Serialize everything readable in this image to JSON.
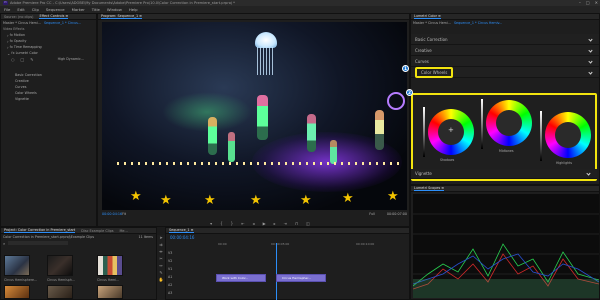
{
  "titlebar": {
    "app_icon": "Pr",
    "title": "Adobe Premiere Pro CC - C:\\Users\\ADOBE\\My Documents\\Adobe\\Premiere Pro\\10.0\\Color Correction in Premiere_start.prproj *",
    "minimize": "–",
    "maximize": "□",
    "close": "✕"
  },
  "menu": [
    "File",
    "Edit",
    "Clip",
    "Sequence",
    "Marker",
    "Title",
    "Window",
    "Help"
  ],
  "left_panel": {
    "tabs": [
      "Source: (no clips)",
      "Effect Controls ≡",
      "Audio Clip Mixer"
    ],
    "master_label": "Master * Circus Hemi...",
    "sequence_label": "Sequence_1 * Circus...",
    "section": "Video Effects",
    "effects": [
      {
        "name": "fx  Motion"
      },
      {
        "name": "fx  Opacity"
      },
      {
        "name": "fx  Time Remapping"
      },
      {
        "name": "fx  Lumetri Color"
      }
    ],
    "lumetri_master": "High Dynamic...",
    "sub_items": [
      "Basic Correction",
      "Creative",
      "Curves",
      "Color Wheels",
      "Vignette"
    ]
  },
  "program": {
    "tab": "Program: Sequence_1 ≡",
    "timecode_left": "00:00:04:16",
    "fit": "Fit",
    "full": "Full",
    "timecode_right": "00:00:07:00"
  },
  "lumetri": {
    "tab": "Lumetri Color ≡",
    "master_label": "Master * Circus Hemi...",
    "sequence_label": "Sequence_1 * Circus Hemiv...",
    "rows": [
      "Basic Correction",
      "Creative",
      "Curves",
      "Color Wheels"
    ],
    "vignette": "Vignette",
    "wheel_labels": [
      "Shadows",
      "Midtones",
      "Highlights"
    ],
    "badges": [
      "1",
      "2"
    ],
    "scopes_tab": "Lumetri Scopes ≡"
  },
  "project": {
    "tabs": [
      "Project: Color Correction in Premiere_start",
      "Disc Example Clips",
      "Me..."
    ],
    "path": "Color Correction in Premiere_start.prproj\\Example Clips",
    "count": "11 Items",
    "thumb_labels": [
      "Circus Hemisphere...",
      "Circus Hemisph...",
      "Circus Hemi..."
    ]
  },
  "timeline": {
    "tab": "Sequence_1 ≡",
    "timecode": "00:00:04:16",
    "ruler": [
      "00:00",
      "00:00:05:00",
      "00:00:10:00"
    ],
    "tracks": [
      "V3",
      "V2",
      "V1",
      "A1",
      "A2",
      "A3"
    ],
    "clips": [
      "Work with Color...",
      "Circus Hemispher..."
    ]
  },
  "colors": {
    "accent_blue": "#2c8ef8",
    "highlight_yellow": "#f2e40f",
    "clip_purple": "#7a6fd0",
    "star_yellow": "#f3c400"
  }
}
